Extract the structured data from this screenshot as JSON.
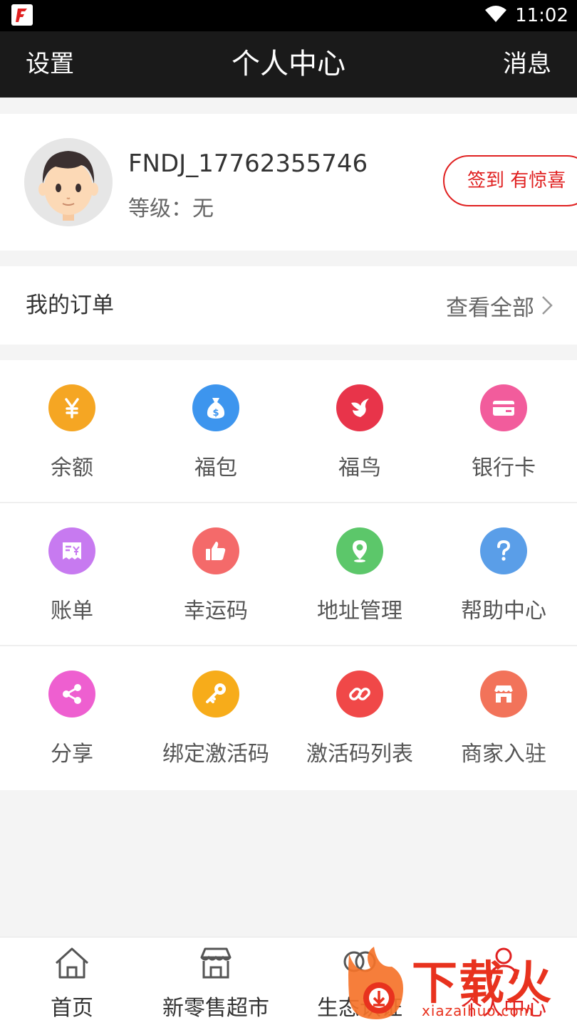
{
  "status_bar": {
    "time": "11:02"
  },
  "header": {
    "left": "设置",
    "title": "个人中心",
    "right": "消息"
  },
  "profile": {
    "username": "FNDJ_17762355746",
    "level": "等级：无",
    "checkin": "签到  有惊喜"
  },
  "orders": {
    "label": "我的订单",
    "view_all": "查看全部"
  },
  "grid": {
    "rows": [
      [
        {
          "label": "余额",
          "icon": "yen-icon",
          "color": "#f5a623"
        },
        {
          "label": "福包",
          "icon": "money-bag-icon",
          "color": "#3d95ee"
        },
        {
          "label": "福鸟",
          "icon": "bird-logo-icon",
          "color": "#e8344a"
        },
        {
          "label": "银行卡",
          "icon": "bank-card-icon",
          "color": "#f25c9c"
        }
      ],
      [
        {
          "label": "账单",
          "icon": "bill-icon",
          "color": "#c77af0"
        },
        {
          "label": "幸运码",
          "icon": "thumbs-up-icon",
          "color": "#f46a6a"
        },
        {
          "label": "地址管理",
          "icon": "location-pin-icon",
          "color": "#5cc76a"
        },
        {
          "label": "帮助中心",
          "icon": "question-icon",
          "color": "#5a9ee8"
        }
      ],
      [
        {
          "label": "分享",
          "icon": "share-icon",
          "color": "#ee5fd0"
        },
        {
          "label": "绑定激活码",
          "icon": "key-icon",
          "color": "#f7ac1a"
        },
        {
          "label": "激活码列表",
          "icon": "link-icon",
          "color": "#f04848"
        },
        {
          "label": "商家入驻",
          "icon": "store-icon",
          "color": "#f2735a"
        }
      ]
    ]
  },
  "tabbar": {
    "items": [
      {
        "label": "首页",
        "icon": "home-icon"
      },
      {
        "label": "新零售超市",
        "icon": "market-icon"
      },
      {
        "label": "生态认证",
        "icon": "ecology-icon"
      },
      {
        "label": "个人中心",
        "icon": "person-icon"
      }
    ]
  },
  "watermark": {
    "text": "下载火",
    "url": "xiazaihuo.com"
  }
}
